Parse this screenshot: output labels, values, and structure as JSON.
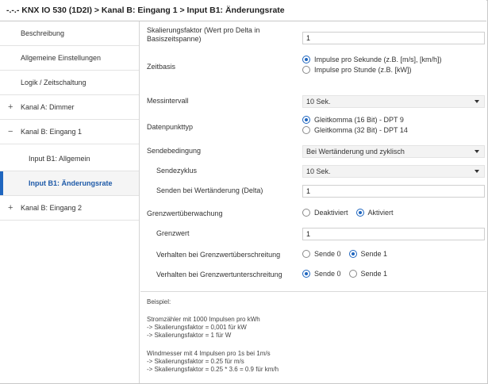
{
  "title": "-.-.- KNX IO 530 (1D2I) > Kanal B: Eingang 1 > Input B1: Änderungsrate",
  "sidebar": {
    "items": [
      {
        "label": "Beschreibung",
        "expander": ""
      },
      {
        "label": "Allgemeine Einstellungen",
        "expander": ""
      },
      {
        "label": "Logik / Zeitschaltung",
        "expander": ""
      },
      {
        "label": "Kanal A: Dimmer",
        "expander": "+"
      },
      {
        "label": "Kanal B: Eingang 1",
        "expander": "−"
      },
      {
        "label": "Input B1: Allgemein",
        "expander": ""
      },
      {
        "label": "Input B1: Änderungsrate",
        "expander": ""
      },
      {
        "label": "Kanal B: Eingang 2",
        "expander": "+"
      }
    ]
  },
  "params": {
    "skalierung": {
      "label": "Skalierungsfaktor (Wert pro Delta in Basiszeitspanne)",
      "value": "1"
    },
    "zeitbasis": {
      "label": "Zeitbasis",
      "options": [
        "Impulse pro Sekunde (z.B. [m/s], [km/h])",
        "Impulse pro Stunde (z.B. [kW])"
      ],
      "selected": 0
    },
    "messintervall": {
      "label": "Messintervall",
      "value": "10 Sek."
    },
    "datenpunkttyp": {
      "label": "Datenpunkttyp",
      "options": [
        "Gleitkomma (16 Bit) - DPT 9",
        "Gleitkomma (32 Bit) - DPT 14"
      ],
      "selected": 0
    },
    "sendebedingung": {
      "label": "Sendebedingung",
      "value": "Bei Wertänderung und zyklisch"
    },
    "sendezyklus": {
      "label": "Sendezyklus",
      "value": "10 Sek."
    },
    "delta": {
      "label": "Senden bei Wertänderung (Delta)",
      "value": "1"
    },
    "grenzwertueberwachung": {
      "label": "Grenzwertüberwachung",
      "options": [
        "Deaktiviert",
        "Aktiviert"
      ],
      "selected": 1
    },
    "grenzwert": {
      "label": "Grenzwert",
      "value": "1"
    },
    "ueberschreitung": {
      "label": "Verhalten bei Grenzwertüberschreitung",
      "options": [
        "Sende 0",
        "Sende 1"
      ],
      "selected": 1
    },
    "unterschreitung": {
      "label": "Verhalten bei Grenzwertunterschreitung",
      "options": [
        "Sende 0",
        "Sende 1"
      ],
      "selected": 0
    }
  },
  "example": {
    "heading": "Beispiel:",
    "block1": [
      "Stromzähler mit 1000 Impulsen pro kWh",
      "-> Skalierungsfaktor = 0,001 für kW",
      "-> Skalierungsfaktor = 1 für W"
    ],
    "block2": [
      "Windmesser mit 4 Impulsen pro 1s bei 1m/s",
      "-> Skalierungsfaktor = 0.25 für m/s",
      "-> Skalierungsfaktor = 0.25 * 3.6 = 0.9 für km/h"
    ]
  },
  "colors": {
    "accent": "#1f66bf",
    "active_text": "#1e5aa8"
  }
}
